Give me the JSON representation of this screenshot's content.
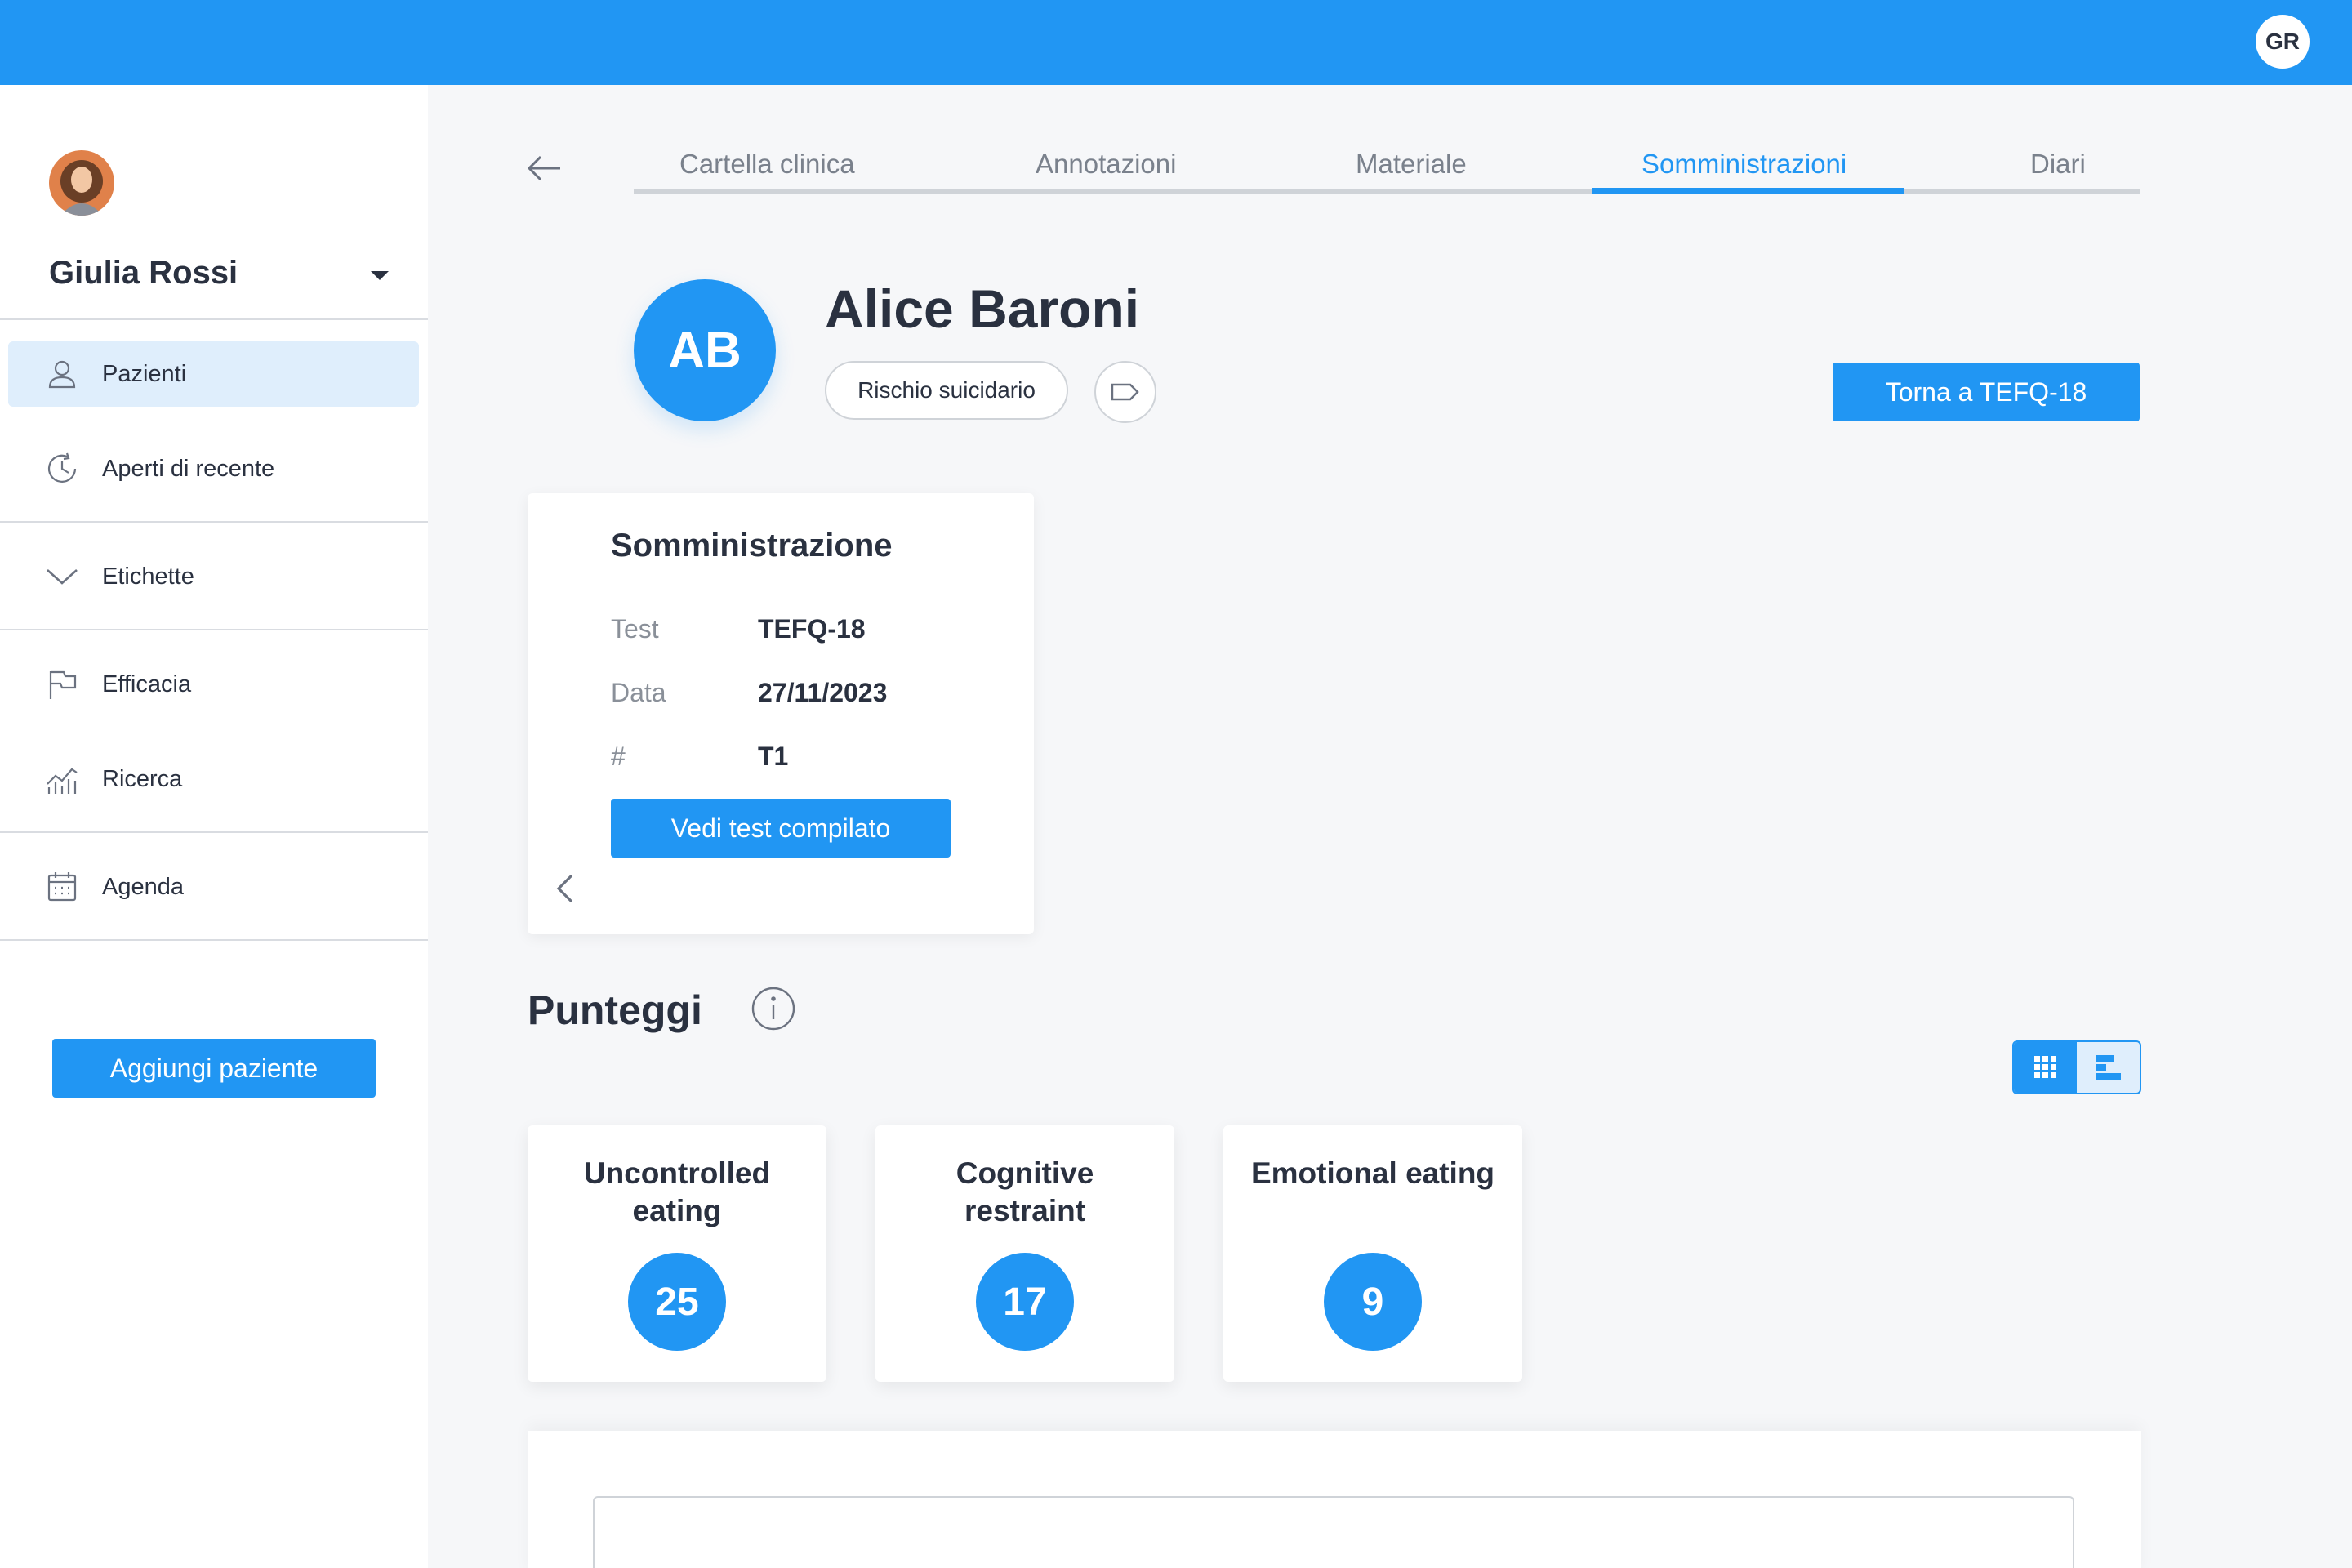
{
  "topbar": {
    "user_initials": "GR"
  },
  "sidebar": {
    "user_name": "Giulia Rossi",
    "items": [
      {
        "label": "Pazienti",
        "icon": "user-icon",
        "active": true
      },
      {
        "label": "Aperti di recente",
        "icon": "clock-icon"
      },
      {
        "label": "Etichette",
        "icon": "chevron-down-icon"
      },
      {
        "label": "Efficacia",
        "icon": "flag-icon"
      },
      {
        "label": "Ricerca",
        "icon": "chart-icon"
      },
      {
        "label": "Agenda",
        "icon": "calendar-icon"
      }
    ],
    "add_patient_label": "Aggiungi paziente"
  },
  "tabs": [
    {
      "label": "Cartella clinica"
    },
    {
      "label": "Annotazioni"
    },
    {
      "label": "Materiale"
    },
    {
      "label": "Somministrazioni",
      "active": true
    },
    {
      "label": "Diari"
    }
  ],
  "patient": {
    "initials": "AB",
    "name": "Alice Baroni",
    "tags": [
      "Rischio suicidario"
    ],
    "back_button_label": "Torna a TEFQ-18"
  },
  "administration": {
    "title": "Somministrazione",
    "rows": [
      {
        "key": "Test",
        "value": "TEFQ-18"
      },
      {
        "key": "Data",
        "value": "27/11/2023"
      },
      {
        "key": "#",
        "value": "T1"
      }
    ],
    "view_button_label": "Vedi test compilato"
  },
  "scores": {
    "title": "Punteggi",
    "items": [
      {
        "label": "Uncontrolled eating",
        "value": "25"
      },
      {
        "label": "Cognitive restraint",
        "value": "17"
      },
      {
        "label": "Emotional eating",
        "value": "9"
      }
    ]
  },
  "colors": {
    "primary": "#2196f3",
    "active_bg": "#dfeefc",
    "text": "#2a3140"
  }
}
